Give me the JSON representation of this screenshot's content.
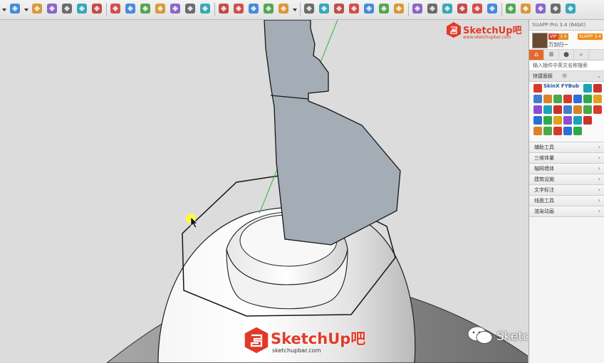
{
  "colors": {
    "accent": "#e44a2a",
    "panel_bg": "#f4f4f4",
    "viewport_bg": "#dcdcdc",
    "section_fill": "#a4adb5"
  },
  "toolbar": {
    "tools": [
      "dropdown-icon",
      "measure-icon",
      "dropdown-icon",
      "move-icon",
      "rotate-icon",
      "scale-icon",
      "offset-icon",
      "eraser-icon",
      "tape-icon",
      "text-icon",
      "paint-icon",
      "orbit-icon",
      "pan-icon",
      "zoom-icon",
      "zoom-extents-icon",
      "warehouse-icon",
      "components-icon",
      "extensions-icon",
      "section-icon",
      "user-icon",
      "dropdown-icon",
      "axes-icon",
      "view-iso-icon",
      "view-top-icon",
      "view-front-icon",
      "view-right-icon",
      "view-back-icon",
      "view-left-icon",
      "xray-icon",
      "hidden-line-icon",
      "wireframe-icon",
      "shaded-icon",
      "textured-icon",
      "monochrome-icon",
      "layout-icon",
      "sandbox-icon",
      "solid-tools-icon",
      "dynamic-icon",
      "extra-icon"
    ]
  },
  "panel": {
    "title": "SUAPP Pro 3.4 (64bit)",
    "user": {
      "vip": "VIP",
      "coin": "3.4",
      "name": "万剑归一",
      "badge": "SUAPP 3.4"
    },
    "tabs": [
      "home-icon",
      "list-icon",
      "user-icon",
      "search-icon"
    ],
    "search_placeholder": "输入插件中英文名称搜索",
    "tools_header": "快捷面板",
    "skin_label": "SkinX FYBub",
    "categories": [
      "辅助工具",
      "三维体量",
      "轴网墙体",
      "建筑设施",
      "文字标注",
      "线面工具",
      "渲染动画"
    ]
  },
  "watermarks": {
    "top_brand": "SketchUp吧",
    "top_url": "www.sketchupbar.com",
    "bottom_brand": "SketchUp吧",
    "bottom_url": "sketchupbar.com",
    "wechat": "SketchUp吧"
  }
}
